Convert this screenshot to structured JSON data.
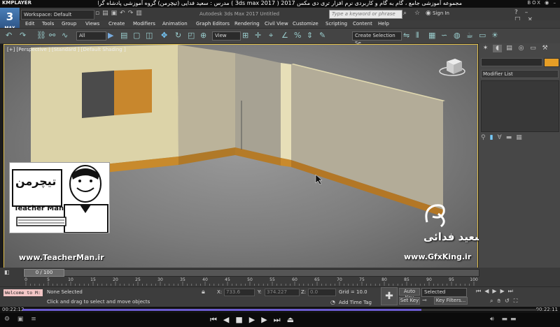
{
  "kmplayer": {
    "logo": "KMPLAYER",
    "title": "مجموعه آموزشی جامع ، گام به گام و کاربردی نرم افزار تری دی مکس 2017 ( 3ds max 2017 )   مدرس : سعید فدایی (تیچرمن) گروه آموزشی پادشاه گرافیست ها",
    "right_label": "BOX ◉ –",
    "time_left": "00:22:12",
    "time_right": "00:22:11"
  },
  "max": {
    "logo": "3",
    "logo_sub": "MAX",
    "workspace": "Workspace: Default",
    "app_title": "Autodesk 3ds Max 2017    Untitled",
    "search_placeholder": "Type a keyword or phrase",
    "signin": "Sign In"
  },
  "menu": [
    "Edit",
    "Tools",
    "Group",
    "Views",
    "Create",
    "Modifiers",
    "Animation",
    "Graph Editors",
    "Rendering",
    "Civil View",
    "Customize",
    "Scripting",
    "Content",
    "Help"
  ],
  "toolbar": {
    "filter": "All",
    "refcoord": "View",
    "selection_set": "Create Selection Se"
  },
  "viewport": {
    "label": "[+] [Perspective ] [Standard ] [Default Shading ]"
  },
  "command_panel": {
    "modifier_list": "Modifier List"
  },
  "overlay": {
    "tm_logo": "Teacher Man",
    "tm_url": "www.TeacherMan.ir",
    "gfx_name": "سعید فدائی",
    "gfx_url": "www.GfxKing.ir"
  },
  "timeline": {
    "handle": "0 / 100",
    "ticks": [
      "0",
      "5",
      "10",
      "15",
      "20",
      "25",
      "30",
      "35",
      "40",
      "45",
      "50",
      "55",
      "60",
      "65",
      "70",
      "75",
      "80",
      "85",
      "90",
      "95",
      "100"
    ]
  },
  "status": {
    "welcome": "Welcome to M:",
    "selected": "None Selected",
    "prompt": "Click and drag to select and move objects",
    "x_label": "X:",
    "x_value": "733.6",
    "y_label": "Y:",
    "y_value": "374.227",
    "z_label": "Z:",
    "z_value": "0.0",
    "grid": "Grid = 10.0",
    "add_time_tag": "Add Time Tag",
    "auto_key": "Auto Key",
    "set_key": "Set Key",
    "selected_dd": "Selected",
    "key_filters": "Key Filters..."
  }
}
